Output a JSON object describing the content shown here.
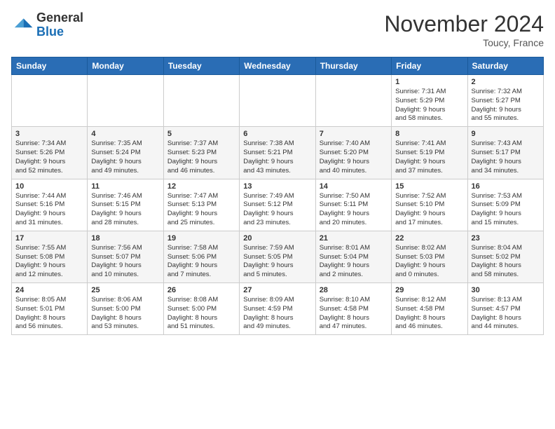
{
  "header": {
    "logo_general": "General",
    "logo_blue": "Blue",
    "month_title": "November 2024",
    "location": "Toucy, France"
  },
  "weekdays": [
    "Sunday",
    "Monday",
    "Tuesday",
    "Wednesday",
    "Thursday",
    "Friday",
    "Saturday"
  ],
  "weeks": [
    [
      {
        "day": "",
        "info": ""
      },
      {
        "day": "",
        "info": ""
      },
      {
        "day": "",
        "info": ""
      },
      {
        "day": "",
        "info": ""
      },
      {
        "day": "",
        "info": ""
      },
      {
        "day": "1",
        "info": "Sunrise: 7:31 AM\nSunset: 5:29 PM\nDaylight: 9 hours\nand 58 minutes."
      },
      {
        "day": "2",
        "info": "Sunrise: 7:32 AM\nSunset: 5:27 PM\nDaylight: 9 hours\nand 55 minutes."
      }
    ],
    [
      {
        "day": "3",
        "info": "Sunrise: 7:34 AM\nSunset: 5:26 PM\nDaylight: 9 hours\nand 52 minutes."
      },
      {
        "day": "4",
        "info": "Sunrise: 7:35 AM\nSunset: 5:24 PM\nDaylight: 9 hours\nand 49 minutes."
      },
      {
        "day": "5",
        "info": "Sunrise: 7:37 AM\nSunset: 5:23 PM\nDaylight: 9 hours\nand 46 minutes."
      },
      {
        "day": "6",
        "info": "Sunrise: 7:38 AM\nSunset: 5:21 PM\nDaylight: 9 hours\nand 43 minutes."
      },
      {
        "day": "7",
        "info": "Sunrise: 7:40 AM\nSunset: 5:20 PM\nDaylight: 9 hours\nand 40 minutes."
      },
      {
        "day": "8",
        "info": "Sunrise: 7:41 AM\nSunset: 5:19 PM\nDaylight: 9 hours\nand 37 minutes."
      },
      {
        "day": "9",
        "info": "Sunrise: 7:43 AM\nSunset: 5:17 PM\nDaylight: 9 hours\nand 34 minutes."
      }
    ],
    [
      {
        "day": "10",
        "info": "Sunrise: 7:44 AM\nSunset: 5:16 PM\nDaylight: 9 hours\nand 31 minutes."
      },
      {
        "day": "11",
        "info": "Sunrise: 7:46 AM\nSunset: 5:15 PM\nDaylight: 9 hours\nand 28 minutes."
      },
      {
        "day": "12",
        "info": "Sunrise: 7:47 AM\nSunset: 5:13 PM\nDaylight: 9 hours\nand 25 minutes."
      },
      {
        "day": "13",
        "info": "Sunrise: 7:49 AM\nSunset: 5:12 PM\nDaylight: 9 hours\nand 23 minutes."
      },
      {
        "day": "14",
        "info": "Sunrise: 7:50 AM\nSunset: 5:11 PM\nDaylight: 9 hours\nand 20 minutes."
      },
      {
        "day": "15",
        "info": "Sunrise: 7:52 AM\nSunset: 5:10 PM\nDaylight: 9 hours\nand 17 minutes."
      },
      {
        "day": "16",
        "info": "Sunrise: 7:53 AM\nSunset: 5:09 PM\nDaylight: 9 hours\nand 15 minutes."
      }
    ],
    [
      {
        "day": "17",
        "info": "Sunrise: 7:55 AM\nSunset: 5:08 PM\nDaylight: 9 hours\nand 12 minutes."
      },
      {
        "day": "18",
        "info": "Sunrise: 7:56 AM\nSunset: 5:07 PM\nDaylight: 9 hours\nand 10 minutes."
      },
      {
        "day": "19",
        "info": "Sunrise: 7:58 AM\nSunset: 5:06 PM\nDaylight: 9 hours\nand 7 minutes."
      },
      {
        "day": "20",
        "info": "Sunrise: 7:59 AM\nSunset: 5:05 PM\nDaylight: 9 hours\nand 5 minutes."
      },
      {
        "day": "21",
        "info": "Sunrise: 8:01 AM\nSunset: 5:04 PM\nDaylight: 9 hours\nand 2 minutes."
      },
      {
        "day": "22",
        "info": "Sunrise: 8:02 AM\nSunset: 5:03 PM\nDaylight: 9 hours\nand 0 minutes."
      },
      {
        "day": "23",
        "info": "Sunrise: 8:04 AM\nSunset: 5:02 PM\nDaylight: 8 hours\nand 58 minutes."
      }
    ],
    [
      {
        "day": "24",
        "info": "Sunrise: 8:05 AM\nSunset: 5:01 PM\nDaylight: 8 hours\nand 56 minutes."
      },
      {
        "day": "25",
        "info": "Sunrise: 8:06 AM\nSunset: 5:00 PM\nDaylight: 8 hours\nand 53 minutes."
      },
      {
        "day": "26",
        "info": "Sunrise: 8:08 AM\nSunset: 5:00 PM\nDaylight: 8 hours\nand 51 minutes."
      },
      {
        "day": "27",
        "info": "Sunrise: 8:09 AM\nSunset: 4:59 PM\nDaylight: 8 hours\nand 49 minutes."
      },
      {
        "day": "28",
        "info": "Sunrise: 8:10 AM\nSunset: 4:58 PM\nDaylight: 8 hours\nand 47 minutes."
      },
      {
        "day": "29",
        "info": "Sunrise: 8:12 AM\nSunset: 4:58 PM\nDaylight: 8 hours\nand 46 minutes."
      },
      {
        "day": "30",
        "info": "Sunrise: 8:13 AM\nSunset: 4:57 PM\nDaylight: 8 hours\nand 44 minutes."
      }
    ]
  ]
}
